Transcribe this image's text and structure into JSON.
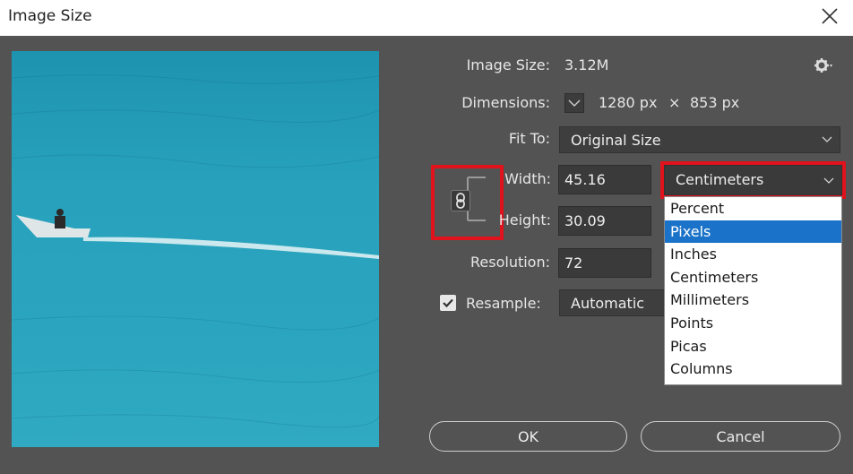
{
  "window": {
    "title": "Image Size"
  },
  "info": {
    "image_size_label": "Image Size:",
    "image_size_value": "3.12M",
    "dimensions_label": "Dimensions:",
    "dim_width": "1280 px",
    "dim_sep": "×",
    "dim_height": "853 px"
  },
  "fit_to": {
    "label": "Fit To:",
    "value": "Original Size"
  },
  "width": {
    "label": "Width:",
    "value": "45.16",
    "unit": "Centimeters"
  },
  "height": {
    "label": "Height:",
    "value": "30.09"
  },
  "resolution": {
    "label": "Resolution:",
    "value": "72"
  },
  "resample": {
    "label": "Resample:",
    "checked": true,
    "value": "Automatic"
  },
  "unit_dropdown": {
    "selected_index": 1,
    "options": [
      "Percent",
      "Pixels",
      "Inches",
      "Centimeters",
      "Millimeters",
      "Points",
      "Picas",
      "Columns"
    ]
  },
  "buttons": {
    "ok": "OK",
    "cancel": "Cancel"
  },
  "colors": {
    "background": "#535353",
    "highlight_box": "#e0121c",
    "selected_option": "#1a73c9"
  }
}
